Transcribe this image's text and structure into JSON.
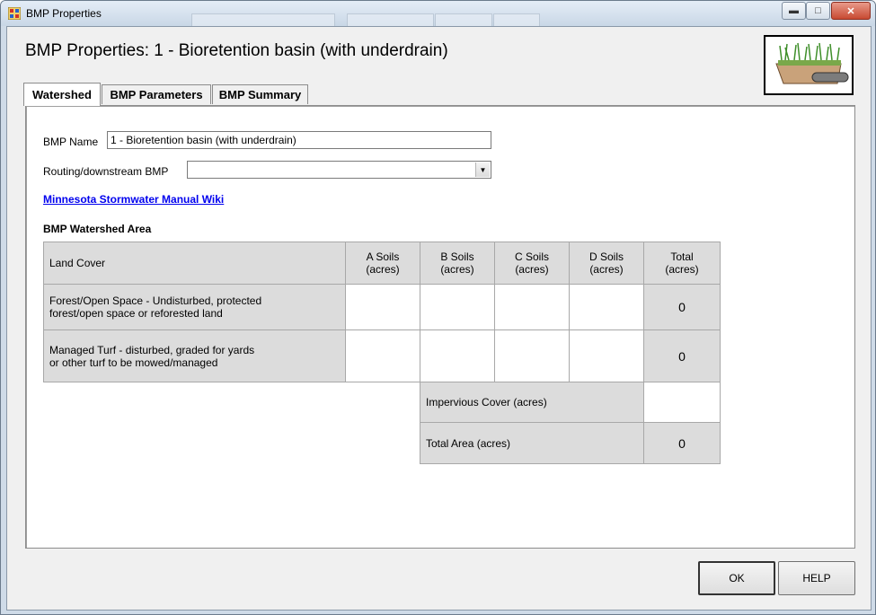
{
  "window": {
    "title": "BMP Properties"
  },
  "header": {
    "title": "BMP Properties: 1 - Bioretention basin (with underdrain)"
  },
  "tabs": [
    {
      "label": "Watershed",
      "active": true
    },
    {
      "label": "BMP Parameters",
      "active": false
    },
    {
      "label": "BMP Summary",
      "active": false
    }
  ],
  "form": {
    "bmp_name_label": "BMP Name",
    "bmp_name_value": "1 - Bioretention basin (with underdrain)",
    "routing_label": "Routing/downstream BMP",
    "routing_value": "",
    "wiki_link": "Minnesota Stormwater Manual Wiki"
  },
  "watershed": {
    "section_title": "BMP Watershed Area",
    "columns": [
      "Land Cover",
      "A Soils\n(acres)",
      "B Soils\n(acres)",
      "C Soils\n(acres)",
      "D Soils\n(acres)",
      "Total\n(acres)"
    ],
    "rows": [
      {
        "label": "Forest/Open Space - Undisturbed,  protected\nforest/open space or reforested land",
        "a": "",
        "b": "",
        "c": "",
        "d": "",
        "total": "0"
      },
      {
        "label": "Managed Turf - disturbed, graded for yards\nor other turf to be mowed/managed",
        "a": "",
        "b": "",
        "c": "",
        "d": "",
        "total": "0"
      }
    ],
    "impervious_label": "Impervious Cover (acres)",
    "impervious_value": "",
    "total_area_label": "Total Area (acres)",
    "total_area_value": "0"
  },
  "buttons": {
    "ok": "OK",
    "help": "HELP"
  },
  "colors": {
    "link": "#0000ee",
    "cell_gray": "#dcdcdc",
    "panel_bg": "#f0f0f0"
  }
}
